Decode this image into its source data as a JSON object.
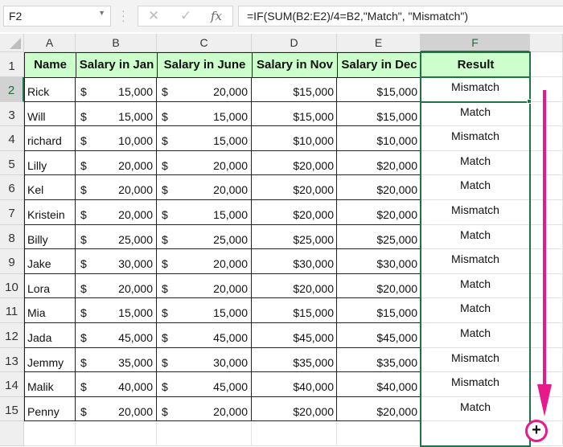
{
  "name_box": {
    "value": "F2"
  },
  "formula_bar": {
    "cancel_icon": "✕",
    "enter_icon": "✓",
    "fx_label": "fx",
    "formula": "=IF(SUM(B2:E2)/4=B2,\"Match\", \"Mismatch\")"
  },
  "columns": [
    "A",
    "B",
    "C",
    "D",
    "E",
    "F"
  ],
  "selected_column": "F",
  "selected_row": "2",
  "headers": [
    "Name",
    "Salary in Jan",
    "Salary in June",
    "Salary in Nov",
    "Salary in Dec",
    "Result"
  ],
  "rows": [
    {
      "num": "1"
    },
    {
      "num": "2",
      "name": "Rick",
      "jan": "15,000",
      "june": "20,000",
      "nov": "$15,000",
      "dec": "$15,000",
      "result": "Mismatch"
    },
    {
      "num": "3",
      "name": "Will",
      "jan": "15,000",
      "june": "15,000",
      "nov": "$15,000",
      "dec": "$15,000",
      "result": "Match"
    },
    {
      "num": "4",
      "name": "richard",
      "jan": "10,000",
      "june": "15,000",
      "nov": "$10,000",
      "dec": "$10,000",
      "result": "Mismatch"
    },
    {
      "num": "5",
      "name": "Lilly",
      "jan": "20,000",
      "june": "20,000",
      "nov": "$20,000",
      "dec": "$20,000",
      "result": "Match"
    },
    {
      "num": "6",
      "name": "Kel",
      "jan": "20,000",
      "june": "20,000",
      "nov": "$20,000",
      "dec": "$20,000",
      "result": "Match"
    },
    {
      "num": "7",
      "name": "Kristein",
      "jan": "20,000",
      "june": "15,000",
      "nov": "$20,000",
      "dec": "$20,000",
      "result": "Mismatch"
    },
    {
      "num": "8",
      "name": "Billy",
      "jan": "25,000",
      "june": "25,000",
      "nov": "$25,000",
      "dec": "$25,000",
      "result": "Match"
    },
    {
      "num": "9",
      "name": "Jake",
      "jan": "30,000",
      "june": "20,000",
      "nov": "$30,000",
      "dec": "$30,000",
      "result": "Mismatch"
    },
    {
      "num": "10",
      "name": "Lora",
      "jan": "20,000",
      "june": "20,000",
      "nov": "$20,000",
      "dec": "$20,000",
      "result": "Match"
    },
    {
      "num": "11",
      "name": "Mia",
      "jan": "15,000",
      "june": "15,000",
      "nov": "$15,000",
      "dec": "$15,000",
      "result": "Match"
    },
    {
      "num": "12",
      "name": "Jada",
      "jan": "45,000",
      "june": "45,000",
      "nov": "$45,000",
      "dec": "$45,000",
      "result": "Match"
    },
    {
      "num": "13",
      "name": "Jemmy",
      "jan": "35,000",
      "june": "30,000",
      "nov": "$35,000",
      "dec": "$35,000",
      "result": "Mismatch"
    },
    {
      "num": "14",
      "name": "Malik",
      "jan": "40,000",
      "june": "45,000",
      "nov": "$40,000",
      "dec": "$40,000",
      "result": "Mismatch"
    },
    {
      "num": "15",
      "name": "Penny",
      "jan": "20,000",
      "june": "20,000",
      "nov": "$20,000",
      "dec": "$20,000",
      "result": "Match"
    }
  ],
  "currency_symbol": "$",
  "annotation": {
    "color": "#e8198b",
    "fill_handle_symbol": "+"
  },
  "accent_color": "#217346",
  "header_fill": "#ccffcc"
}
